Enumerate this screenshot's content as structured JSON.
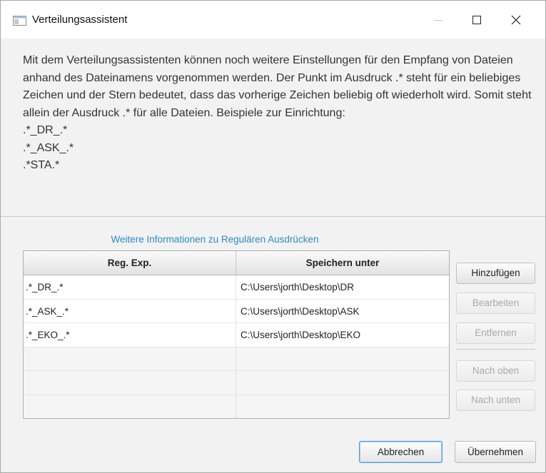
{
  "window": {
    "title": "Verteilungsassistent",
    "controls": {
      "minimize": "minimize",
      "maximize": "maximize",
      "close": "✕"
    }
  },
  "intro": {
    "text": "Mit dem Verteilungsassistenten können noch weitere Einstellungen für den Empfang von Dateien anhand des Dateinamens vorgenommen werden. Der Punkt im Ausdruck .* steht für ein beliebiges Zeichen und der Stern bedeutet, dass das vorherige Zeichen beliebig oft wiederholt wird. Somit steht allein der Ausdruck .* für alle Dateien. Beispiele zur Einrichtung:",
    "examples": [
      ".*_DR_.*",
      ".*_ASK_.*",
      ".*STA.*"
    ]
  },
  "info_link": "Weitere Informationen zu Regulären Ausdrücken",
  "table": {
    "columns": [
      "Reg. Exp.",
      "Speichern unter"
    ],
    "rows": [
      [
        ".*_DR_.*",
        "C:\\Users\\jorth\\Desktop\\DR"
      ],
      [
        ".*_ASK_.*",
        "C:\\Users\\jorth\\Desktop\\ASK"
      ],
      [
        ".*_EKO_.*",
        "C:\\Users\\jorth\\Desktop\\EKO"
      ]
    ]
  },
  "side_buttons": {
    "add": "Hinzufügen",
    "edit": "Bearbeiten",
    "remove": "Entfernen",
    "up": "Nach oben",
    "down": "Nach unten"
  },
  "footer": {
    "cancel": "Abbrechen",
    "apply": "Übernehmen"
  },
  "colors": {
    "link": "#2b8bc8",
    "focus_border": "#4f9be0",
    "disabled_text": "#a9a9a9"
  }
}
